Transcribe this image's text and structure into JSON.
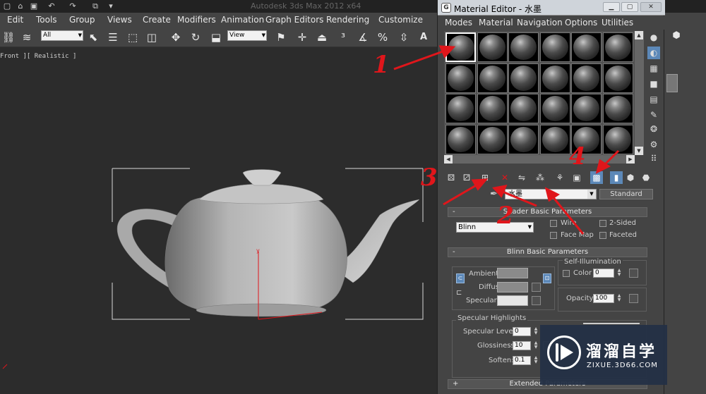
{
  "max": {
    "app_title": "Autodesk 3ds Max 2012 x64",
    "menus": [
      "Edit",
      "Tools",
      "Group",
      "Views",
      "Create",
      "Modifiers",
      "Animation",
      "Graph Editors",
      "Rendering",
      "Customize"
    ],
    "selection_filter": "All",
    "reference_coord": "View",
    "viewport_label": "Front ][ Realistic ]",
    "gizmo_label": "y"
  },
  "material_editor": {
    "title": "Material Editor - 水墨",
    "menus": [
      "Modes",
      "Material",
      "Navigation",
      "Options",
      "Utilities"
    ],
    "material_name": "水墨",
    "material_type": "Standard",
    "sample_slots": 24,
    "active_slot": 1,
    "shader_basic": {
      "header": "Shader Basic Parameters",
      "shader": "Blinn",
      "wire": "Wire",
      "two_sided": "2-Sided",
      "face_map": "Face Map",
      "faceted": "Faceted"
    },
    "blinn_basic": {
      "header": "Blinn Basic Parameters",
      "self_illum_title": "Self-Illumination",
      "color_label": "Color",
      "color_value": "0",
      "ambient_label": "Ambient:",
      "diffuse_label": "Diffuse:",
      "specular_label": "Specular:",
      "opacity_label": "Opacity:",
      "opacity_value": "100",
      "ambient_color": "#8a8a8a",
      "diffuse_color": "#8a8a8a",
      "specular_color": "#e6e6e6"
    },
    "specular_highlights": {
      "title": "Specular Highlights",
      "level_label": "Specular Level:",
      "level_value": "0",
      "gloss_label": "Glossiness:",
      "gloss_value": "10",
      "soften_label": "Soften:",
      "soften_value": "0.1"
    },
    "extended_header": "Extended Parameters"
  },
  "annotations": [
    "1",
    "2",
    "3",
    "4"
  ],
  "annotation_color": "#e0161b",
  "watermark": {
    "text_cn": "溜溜自学",
    "url": "ZIXUE.3D66.COM"
  }
}
